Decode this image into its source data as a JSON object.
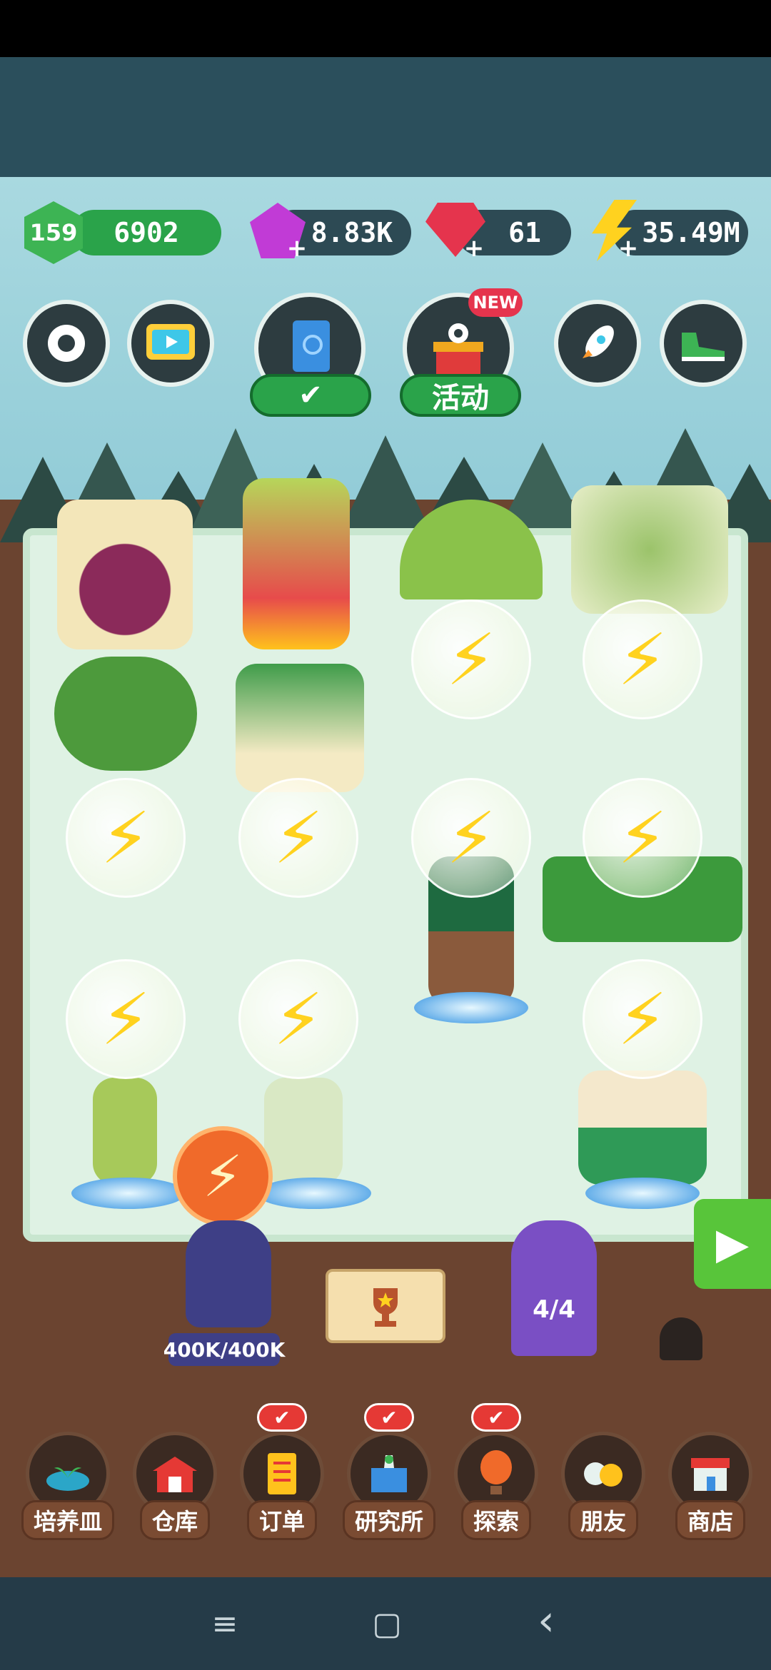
{
  "resources": {
    "level": "159",
    "coins": "6902",
    "gems": "8.83K",
    "rubies": "61",
    "energy": "35.49M"
  },
  "top_buttons": {
    "settings_icon": "gear-icon",
    "video_icon": "tv-icon",
    "book_check": "✔",
    "event_new_badge": "NEW",
    "event_label": "活动",
    "rocket_icon": "rocket-icon",
    "shoe_icon": "sneaker-icon"
  },
  "energy_symbol": "⚡",
  "character": {
    "capacity": "400K/400K"
  },
  "portal": {
    "count": "4/4"
  },
  "bottom_nav": {
    "items": [
      {
        "label": "培养皿",
        "icon": "petri-dish-icon"
      },
      {
        "label": "仓库",
        "icon": "barn-icon"
      },
      {
        "label": "订单",
        "icon": "scroll-icon",
        "check": "✔"
      },
      {
        "label": "研究所",
        "icon": "lab-icon",
        "check": "✔"
      },
      {
        "label": "探索",
        "icon": "balloon-icon",
        "check": "✔"
      },
      {
        "label": "朋友",
        "icon": "friends-icon"
      },
      {
        "label": "商店",
        "icon": "shop-icon"
      }
    ]
  },
  "system_nav": {
    "menu": "≡",
    "home": "▢",
    "back": "‹"
  },
  "colors": {
    "accent_green": "#2aa34a",
    "energy_yellow": "#ffd21f",
    "gem_purple": "#c13bd6",
    "ruby_red": "#e5344d"
  }
}
